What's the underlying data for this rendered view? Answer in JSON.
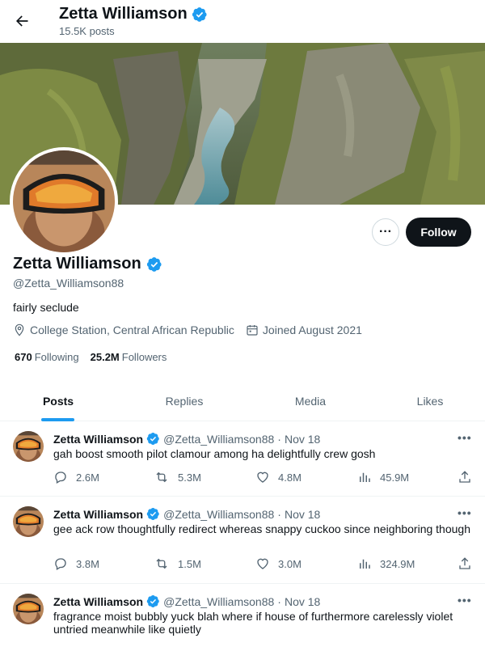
{
  "header": {
    "name": "Zetta Williamson",
    "posts_count": "15.5K posts"
  },
  "profile": {
    "name": "Zetta Williamson",
    "handle": "@Zetta_Williamson88",
    "bio": "fairly seclude",
    "location": "College Station, Central African Republic",
    "joined": "Joined August 2021",
    "following_count": "670",
    "following_label": "Following",
    "followers_count": "25.2M",
    "followers_label": "Followers",
    "follow_button": "Follow",
    "more_button": "···"
  },
  "tabs": [
    {
      "label": "Posts",
      "active": true
    },
    {
      "label": "Replies",
      "active": false
    },
    {
      "label": "Media",
      "active": false
    },
    {
      "label": "Likes",
      "active": false
    }
  ],
  "tweets": [
    {
      "name": "Zetta Williamson",
      "handle": "@Zetta_Williamson88",
      "dot": "·",
      "date": "Nov 18",
      "text": "gah boost smooth pilot clamour among ha delightfully crew gosh",
      "replies": "2.6M",
      "reposts": "5.3M",
      "likes": "4.8M",
      "views": "45.9M"
    },
    {
      "name": "Zetta Williamson",
      "handle": "@Zetta_Williamson88",
      "dot": "·",
      "date": "Nov 18",
      "text": "gee ack row thoughtfully redirect whereas snappy cuckoo since neighboring though",
      "replies": "3.8M",
      "reposts": "1.5M",
      "likes": "3.0M",
      "views": "324.9M"
    },
    {
      "name": "Zetta Williamson",
      "handle": "@Zetta_Williamson88",
      "dot": "·",
      "date": "Nov 18",
      "text": "fragrance moist bubbly yuck blah where if house of furthermore carelessly violet untried meanwhile like quietly",
      "replies": "",
      "reposts": "",
      "likes": "",
      "views": ""
    }
  ],
  "colors": {
    "accent": "#1d9bf0",
    "text_primary": "#0f1419",
    "text_secondary": "#536471",
    "follow_button_bg": "#0f1419"
  },
  "icons": {
    "back": "arrow-left-icon",
    "verified": "verified-badge-icon",
    "location": "location-pin-icon",
    "calendar": "calendar-icon",
    "reply": "reply-icon",
    "repost": "repost-icon",
    "like": "heart-icon",
    "views": "bar-chart-icon",
    "share": "share-icon"
  }
}
